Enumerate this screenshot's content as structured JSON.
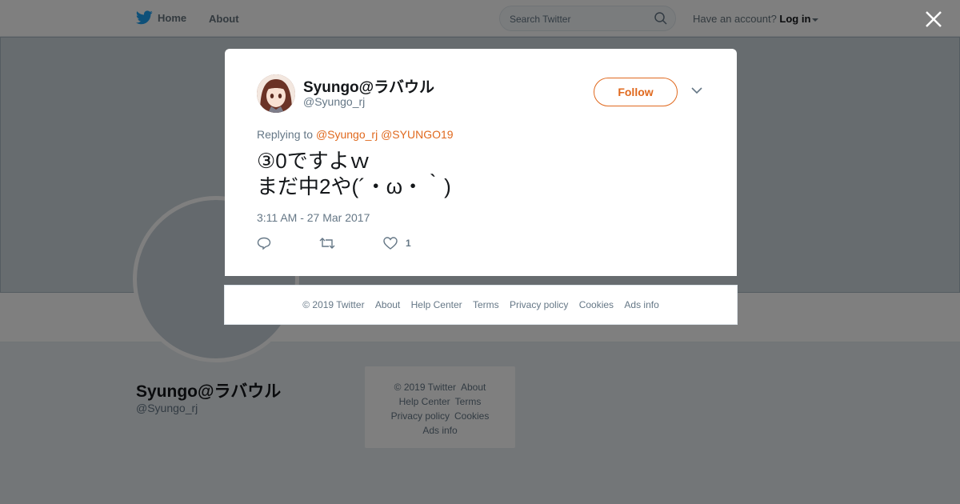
{
  "topbar": {
    "home_label": "Home",
    "about_label": "About",
    "search_placeholder": "Search Twitter",
    "account_prompt": "Have an account?",
    "login_label": "Log in"
  },
  "profile": {
    "name": "Syungo@ラバウル",
    "handle": "@Syungo_rj"
  },
  "sidebar_footer": {
    "copyright": "© 2019 Twitter",
    "about": "About",
    "help_center": "Help Center",
    "terms": "Terms",
    "privacy": "Privacy policy",
    "cookies": "Cookies",
    "ads_info": "Ads info"
  },
  "tweet": {
    "author_name": "Syungo@ラバウル",
    "author_handle": "@Syungo_rj",
    "follow_label": "Follow",
    "replying_prefix": "Replying to",
    "reply_mention_1": "@Syungo_rj",
    "reply_mention_2": "@SYUNGO19",
    "text": "③0ですよｗ\nまだ中2や(´・ω・｀)",
    "timestamp": "3:11 AM - 27 Mar 2017",
    "like_count": "1"
  },
  "modal_footer": {
    "copyright": "© 2019 Twitter",
    "about": "About",
    "help_center": "Help Center",
    "terms": "Terms",
    "privacy": "Privacy policy",
    "cookies": "Cookies",
    "ads_info": "Ads info"
  },
  "colors": {
    "accent": "#e0691e",
    "twitter_blue": "#1da1f2",
    "muted": "#657786"
  }
}
